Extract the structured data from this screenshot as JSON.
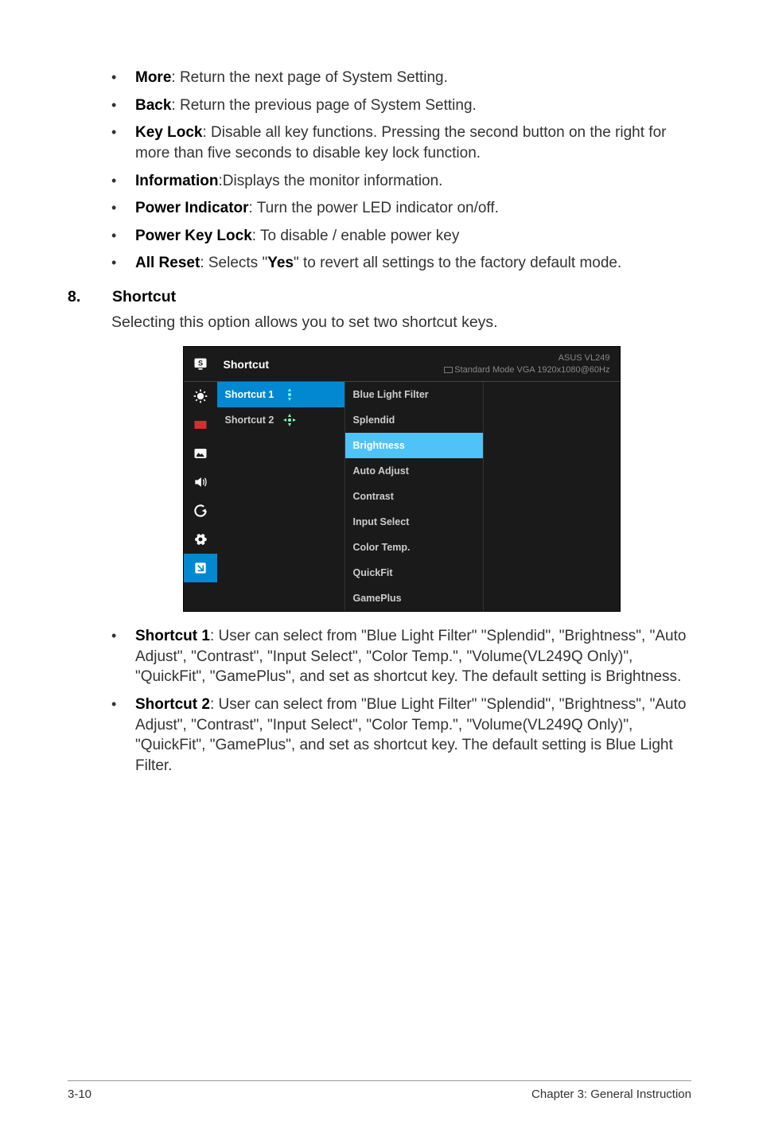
{
  "toplist": {
    "more": {
      "label": "More",
      "desc": ": Return the next page of System Setting."
    },
    "back": {
      "label": "Back",
      "desc": ": Return the previous page of System Setting."
    },
    "keylock": {
      "label": "Key Lock",
      "desc": ": Disable all key functions. Pressing the second button on the right for more than five seconds to disable key lock function."
    },
    "info": {
      "label": "Information",
      "desc": ":Displays the monitor information."
    },
    "powerind": {
      "label": "Power Indicator",
      "desc": ": Turn the power LED indicator on/off."
    },
    "powerkey": {
      "label": "Power Key Lock",
      "desc": ": To disable / enable power key"
    },
    "allreset": {
      "label": "All Reset",
      "prefix": ": Selects \"",
      "yes": "Yes",
      "suffix": "\" to revert all settings to the factory default mode."
    }
  },
  "section": {
    "num": "8.",
    "title": "Shortcut",
    "subtitle": "Selecting this option allows you to set two shortcut keys."
  },
  "osd": {
    "title": "Shortcut",
    "brand": "ASUS  VL249",
    "mode": "Standard Mode  VGA  1920x1080@60Hz",
    "col1": {
      "shortcut1": "Shortcut 1",
      "shortcut2": "Shortcut 2"
    },
    "col2": {
      "bluelight": "Blue Light Filter",
      "splendid": "Splendid",
      "brightness": "Brightness",
      "autoadjust": "Auto Adjust",
      "contrast": "Contrast",
      "inputselect": "Input Select",
      "colortemp": "Color Temp.",
      "quickfit": "QuickFit",
      "gameplus": "GamePlus"
    }
  },
  "bottomlist": {
    "sc1": {
      "label": "Shortcut 1",
      "desc": ": User can select from \"Blue Light Filter\" \"Splendid\", \"Brightness\", \"Auto Adjust\", \"Contrast\", \"Input Select\", \"Color Temp.\", \"Volume(VL249Q Only)\", \"QuickFit\", \"GamePlus\", and set as shortcut key. The default setting is Brightness."
    },
    "sc2": {
      "label": "Shortcut 2",
      "desc": ": User can select from \"Blue Light Filter\" \"Splendid\", \"Brightness\", \"Auto Adjust\", \"Contrast\", \"Input Select\", \"Color Temp.\", \"Volume(VL249Q Only)\", \"QuickFit\", \"GamePlus\", and set as shortcut key. The default setting is Blue Light Filter."
    }
  },
  "footer": {
    "left": "3-10",
    "right": "Chapter 3: General Instruction"
  }
}
